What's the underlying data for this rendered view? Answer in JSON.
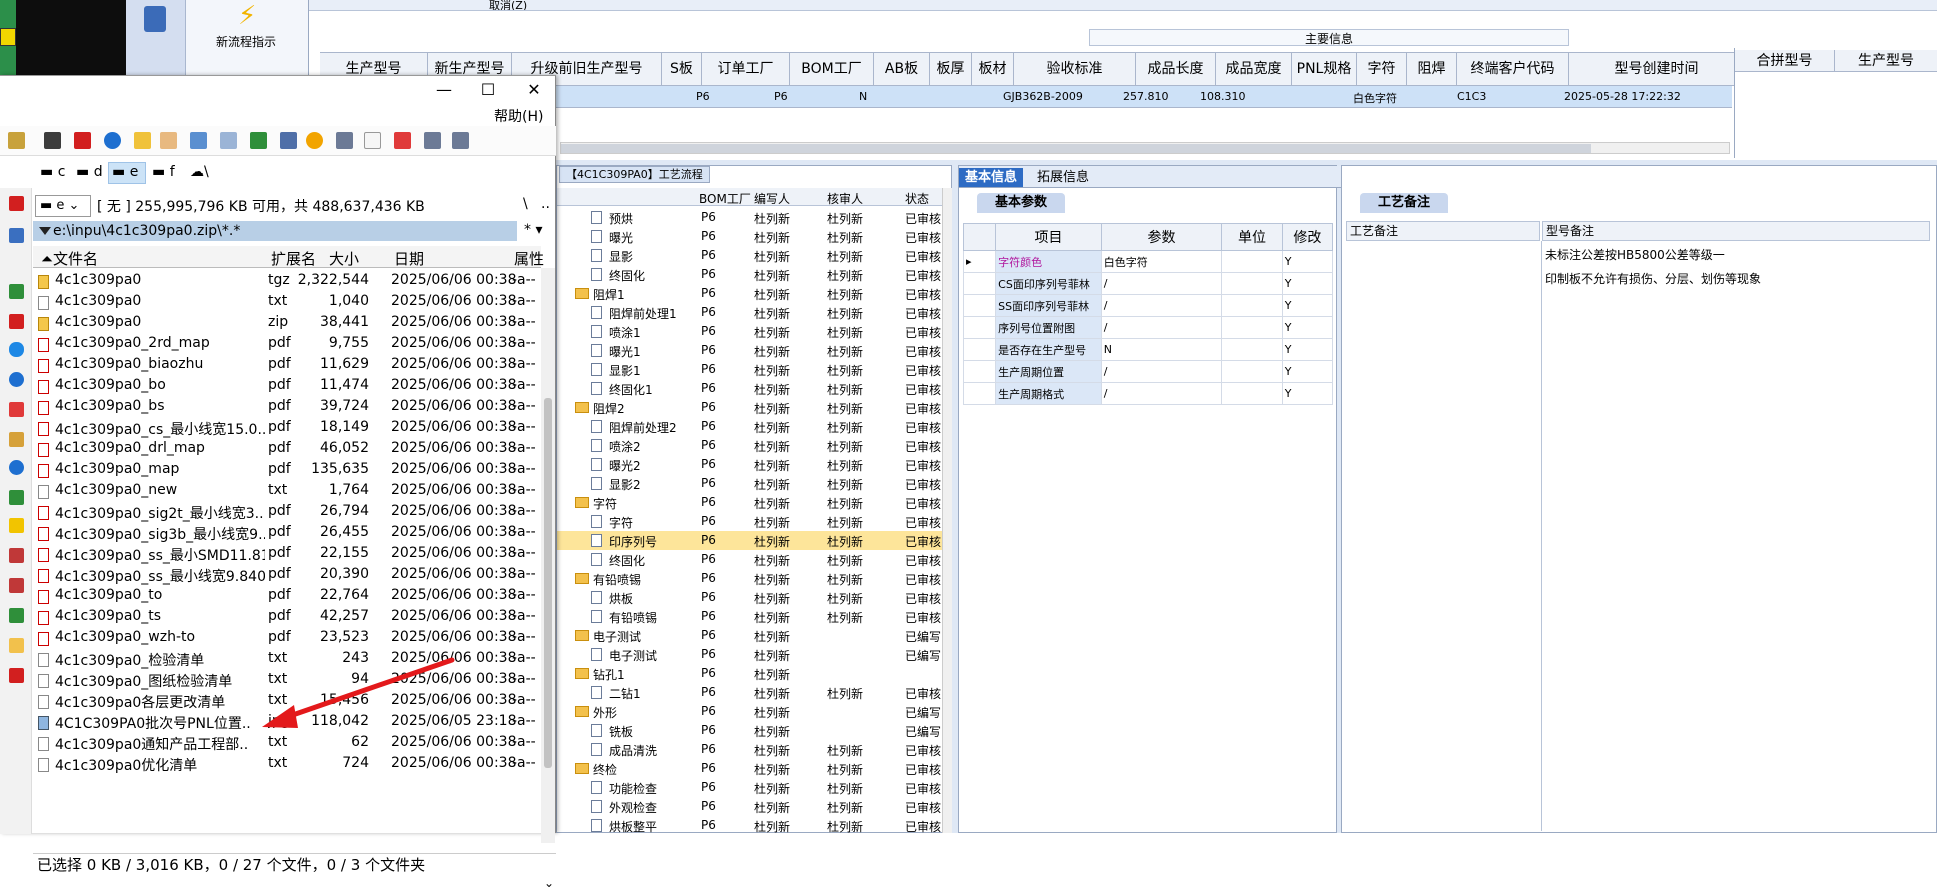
{
  "erp": {
    "toolbar": {
      "new_process_label": "新流程指示",
      "cancel_label": "取消(Z)"
    },
    "main_info_title": "主要信息",
    "columns": [
      "生产型号",
      "新生产型号",
      "升级前旧生产型号",
      "S板",
      "订单工厂",
      "BOM工厂",
      "AB板",
      "板厚",
      "板材",
      "验收标准",
      "成品长度",
      "成品宽度",
      "PNL规格",
      "字符",
      "阻焊",
      "终端客户代码",
      "型号创建时间"
    ],
    "right_columns": [
      "合拼型号",
      "生产型号"
    ],
    "selected_row": {
      "order_factory": "P6",
      "bom_factory": "P6",
      "ab": "N",
      "standard": "GJB362B-2009",
      "length": "257.810",
      "width": "108.310",
      "character": "白色字符",
      "customer": "C1C3",
      "created": "2025-05-28 17:22:32"
    },
    "process_tab": "【4C1C309PA0】工艺流程",
    "process_columns": [
      "BOM工厂",
      "编写人",
      "核审人",
      "状态"
    ],
    "process_rows": [
      {
        "name": "预烘",
        "indent": 2,
        "folder": false,
        "bom": "P6",
        "writer": "杜列新",
        "reviewer": "杜列新",
        "status": "已审核"
      },
      {
        "name": "曝光",
        "indent": 2,
        "folder": false,
        "bom": "P6",
        "writer": "杜列新",
        "reviewer": "杜列新",
        "status": "已审核"
      },
      {
        "name": "显影",
        "indent": 2,
        "folder": false,
        "bom": "P6",
        "writer": "杜列新",
        "reviewer": "杜列新",
        "status": "已审核"
      },
      {
        "name": "终固化",
        "indent": 2,
        "folder": false,
        "bom": "P6",
        "writer": "杜列新",
        "reviewer": "杜列新",
        "status": "已审核"
      },
      {
        "name": "阻焊1",
        "indent": 1,
        "folder": true,
        "bom": "P6",
        "writer": "杜列新",
        "reviewer": "杜列新",
        "status": "已审核"
      },
      {
        "name": "阻焊前处理1",
        "indent": 2,
        "folder": false,
        "bom": "P6",
        "writer": "杜列新",
        "reviewer": "杜列新",
        "status": "已审核"
      },
      {
        "name": "喷涂1",
        "indent": 2,
        "folder": false,
        "bom": "P6",
        "writer": "杜列新",
        "reviewer": "杜列新",
        "status": "已审核"
      },
      {
        "name": "曝光1",
        "indent": 2,
        "folder": false,
        "bom": "P6",
        "writer": "杜列新",
        "reviewer": "杜列新",
        "status": "已审核"
      },
      {
        "name": "显影1",
        "indent": 2,
        "folder": false,
        "bom": "P6",
        "writer": "杜列新",
        "reviewer": "杜列新",
        "status": "已审核"
      },
      {
        "name": "终固化1",
        "indent": 2,
        "folder": false,
        "bom": "P6",
        "writer": "杜列新",
        "reviewer": "杜列新",
        "status": "已审核"
      },
      {
        "name": "阻焊2",
        "indent": 1,
        "folder": true,
        "bom": "P6",
        "writer": "杜列新",
        "reviewer": "杜列新",
        "status": "已审核"
      },
      {
        "name": "阻焊前处理2",
        "indent": 2,
        "folder": false,
        "bom": "P6",
        "writer": "杜列新",
        "reviewer": "杜列新",
        "status": "已审核"
      },
      {
        "name": "喷涂2",
        "indent": 2,
        "folder": false,
        "bom": "P6",
        "writer": "杜列新",
        "reviewer": "杜列新",
        "status": "已审核"
      },
      {
        "name": "曝光2",
        "indent": 2,
        "folder": false,
        "bom": "P6",
        "writer": "杜列新",
        "reviewer": "杜列新",
        "status": "已审核"
      },
      {
        "name": "显影2",
        "indent": 2,
        "folder": false,
        "bom": "P6",
        "writer": "杜列新",
        "reviewer": "杜列新",
        "status": "已审核"
      },
      {
        "name": "字符",
        "indent": 1,
        "folder": true,
        "bom": "P6",
        "writer": "杜列新",
        "reviewer": "杜列新",
        "status": "已审核"
      },
      {
        "name": "字符",
        "indent": 2,
        "folder": false,
        "bom": "P6",
        "writer": "杜列新",
        "reviewer": "杜列新",
        "status": "已审核"
      },
      {
        "name": "印序列号",
        "indent": 2,
        "folder": false,
        "bom": "P6",
        "writer": "杜列新",
        "reviewer": "杜列新",
        "status": "已审核",
        "highlight": true
      },
      {
        "name": "终固化",
        "indent": 2,
        "folder": false,
        "bom": "P6",
        "writer": "杜列新",
        "reviewer": "杜列新",
        "status": "已审核"
      },
      {
        "name": "有铅喷锡",
        "indent": 1,
        "folder": true,
        "bom": "P6",
        "writer": "杜列新",
        "reviewer": "杜列新",
        "status": "已审核"
      },
      {
        "name": "烘板",
        "indent": 2,
        "folder": false,
        "bom": "P6",
        "writer": "杜列新",
        "reviewer": "杜列新",
        "status": "已审核"
      },
      {
        "name": "有铅喷锡",
        "indent": 2,
        "folder": false,
        "bom": "P6",
        "writer": "杜列新",
        "reviewer": "杜列新",
        "status": "已审核"
      },
      {
        "name": "电子测试",
        "indent": 1,
        "folder": true,
        "bom": "P6",
        "writer": "杜列新",
        "reviewer": "",
        "status": "已编写"
      },
      {
        "name": "电子测试",
        "indent": 2,
        "folder": false,
        "bom": "P6",
        "writer": "杜列新",
        "reviewer": "",
        "status": "已编写"
      },
      {
        "name": "钻孔1",
        "indent": 1,
        "folder": true,
        "bom": "P6",
        "writer": "杜列新",
        "reviewer": "",
        "status": ""
      },
      {
        "name": "二钻1",
        "indent": 2,
        "folder": false,
        "bom": "P6",
        "writer": "杜列新",
        "reviewer": "杜列新",
        "status": "已审核"
      },
      {
        "name": "外形",
        "indent": 1,
        "folder": true,
        "bom": "P6",
        "writer": "杜列新",
        "reviewer": "",
        "status": "已编写"
      },
      {
        "name": "铣板",
        "indent": 2,
        "folder": false,
        "bom": "P6",
        "writer": "杜列新",
        "reviewer": "",
        "status": "已编写"
      },
      {
        "name": "成品清洗",
        "indent": 2,
        "folder": false,
        "bom": "P6",
        "writer": "杜列新",
        "reviewer": "杜列新",
        "status": "已审核"
      },
      {
        "name": "终检",
        "indent": 1,
        "folder": true,
        "bom": "P6",
        "writer": "杜列新",
        "reviewer": "杜列新",
        "status": "已审核"
      },
      {
        "name": "功能检查",
        "indent": 2,
        "folder": false,
        "bom": "P6",
        "writer": "杜列新",
        "reviewer": "杜列新",
        "status": "已审核"
      },
      {
        "name": "外观检查",
        "indent": 2,
        "folder": false,
        "bom": "P6",
        "writer": "杜列新",
        "reviewer": "杜列新",
        "status": "已审核"
      },
      {
        "name": "烘板整平",
        "indent": 2,
        "folder": false,
        "bom": "P6",
        "writer": "杜列新",
        "reviewer": "杜列新",
        "status": "已审核"
      }
    ],
    "basic_tabs": [
      "基本信息",
      "拓展信息"
    ],
    "basic_sub": "基本参数",
    "param_columns": [
      "项目",
      "参数",
      "单位",
      "修改"
    ],
    "params": [
      {
        "item": "字符颜色",
        "value": "白色字符",
        "unit": "",
        "mod": "Y"
      },
      {
        "item": "CS面印序列号菲林",
        "value": "/",
        "unit": "",
        "mod": "Y"
      },
      {
        "item": "SS面印序列号菲林",
        "value": "/",
        "unit": "",
        "mod": "Y"
      },
      {
        "item": "序列号位置附图",
        "value": "/",
        "unit": "",
        "mod": "Y"
      },
      {
        "item": "是否存在生产型号",
        "value": "N",
        "unit": "",
        "mod": "Y"
      },
      {
        "item": "生产周期位置",
        "value": "/",
        "unit": "",
        "mod": "Y"
      },
      {
        "item": "生产周期格式",
        "value": "/",
        "unit": "",
        "mod": "Y"
      }
    ],
    "note_tab": "工艺备注",
    "note_col1": "工艺备注",
    "note_col2": "型号备注",
    "notes": [
      "未标注公差按HB5800公差等级一",
      "印制板不允许有损伤、分层、划伤等现象"
    ]
  },
  "fm": {
    "help_menu": "帮助(H)",
    "drives": [
      "c",
      "d",
      "e",
      "f",
      "\\"
    ],
    "drive_combo": "e",
    "free_space": "[ 无 ] 255,995,796 KB 可用，共 488,637,436 KB",
    "nav_back": "\\",
    "nav_up": "..",
    "path": "e:\\inpu\\4c1c309pa0.zip\\*.*",
    "path_right": "* ▾",
    "columns": [
      "文件名",
      "扩展名",
      "大小",
      "日期",
      "属性"
    ],
    "files": [
      {
        "name": "4c1c309pa0",
        "ext": "tgz",
        "size": "2,322,544",
        "date": "2025/06/06 00:38",
        "attr": "-a--",
        "type": "zip"
      },
      {
        "name": "4c1c309pa0",
        "ext": "txt",
        "size": "1,040",
        "date": "2025/06/06 00:38",
        "attr": "-a--",
        "type": "txt"
      },
      {
        "name": "4c1c309pa0",
        "ext": "zip",
        "size": "38,441",
        "date": "2025/06/06 00:38",
        "attr": "-a--",
        "type": "zip"
      },
      {
        "name": "4c1c309pa0_2rd_map",
        "ext": "pdf",
        "size": "9,755",
        "date": "2025/06/06 00:38",
        "attr": "-a--",
        "type": "pdf"
      },
      {
        "name": "4c1c309pa0_biaozhu",
        "ext": "pdf",
        "size": "11,629",
        "date": "2025/06/06 00:38",
        "attr": "-a--",
        "type": "pdf"
      },
      {
        "name": "4c1c309pa0_bo",
        "ext": "pdf",
        "size": "11,474",
        "date": "2025/06/06 00:38",
        "attr": "-a--",
        "type": "pdf"
      },
      {
        "name": "4c1c309pa0_bs",
        "ext": "pdf",
        "size": "39,724",
        "date": "2025/06/06 00:38",
        "attr": "-a--",
        "type": "pdf"
      },
      {
        "name": "4c1c309pa0_cs_最小线宽15.0..",
        "ext": "pdf",
        "size": "18,149",
        "date": "2025/06/06 00:38",
        "attr": "-a--",
        "type": "pdf"
      },
      {
        "name": "4c1c309pa0_drl_map",
        "ext": "pdf",
        "size": "46,052",
        "date": "2025/06/06 00:38",
        "attr": "-a--",
        "type": "pdf"
      },
      {
        "name": "4c1c309pa0_map",
        "ext": "pdf",
        "size": "135,635",
        "date": "2025/06/06 00:38",
        "attr": "-a--",
        "type": "pdf"
      },
      {
        "name": "4c1c309pa0_new",
        "ext": "txt",
        "size": "1,764",
        "date": "2025/06/06 00:38",
        "attr": "-a--",
        "type": "txt"
      },
      {
        "name": "4c1c309pa0_sig2t_最小线宽3..",
        "ext": "pdf",
        "size": "26,794",
        "date": "2025/06/06 00:38",
        "attr": "-a--",
        "type": "pdf"
      },
      {
        "name": "4c1c309pa0_sig3b_最小线宽9..",
        "ext": "pdf",
        "size": "26,455",
        "date": "2025/06/06 00:38",
        "attr": "-a--",
        "type": "pdf"
      },
      {
        "name": "4c1c309pa0_ss_最小SMD11.81",
        "ext": "pdf",
        "size": "22,155",
        "date": "2025/06/06 00:38",
        "attr": "-a--",
        "type": "pdf"
      },
      {
        "name": "4c1c309pa0_ss_最小线宽9.840",
        "ext": "pdf",
        "size": "20,390",
        "date": "2025/06/06 00:38",
        "attr": "-a--",
        "type": "pdf"
      },
      {
        "name": "4c1c309pa0_to",
        "ext": "pdf",
        "size": "22,764",
        "date": "2025/06/06 00:38",
        "attr": "-a--",
        "type": "pdf"
      },
      {
        "name": "4c1c309pa0_ts",
        "ext": "pdf",
        "size": "42,257",
        "date": "2025/06/06 00:38",
        "attr": "-a--",
        "type": "pdf"
      },
      {
        "name": "4c1c309pa0_wzh-to",
        "ext": "pdf",
        "size": "23,523",
        "date": "2025/06/06 00:38",
        "attr": "-a--",
        "type": "pdf"
      },
      {
        "name": "4c1c309pa0_检验清单",
        "ext": "txt",
        "size": "243",
        "date": "2025/06/06 00:38",
        "attr": "-a--",
        "type": "txt"
      },
      {
        "name": "4c1c309pa0_图纸检验清单",
        "ext": "txt",
        "size": "94",
        "date": "2025/06/06 00:38",
        "attr": "-a--",
        "type": "txt"
      },
      {
        "name": "4c1c309pa0各层更改清单",
        "ext": "txt",
        "size": "15,456",
        "date": "2025/06/06 00:38",
        "attr": "-a--",
        "type": "txt"
      },
      {
        "name": "4C1C309PA0批次号PNL位置..",
        "ext": "jpg",
        "size": "118,042",
        "date": "2025/06/05 23:18",
        "attr": "-a--",
        "type": "jpg"
      },
      {
        "name": "4c1c309pa0通知产品工程部..",
        "ext": "txt",
        "size": "62",
        "date": "2025/06/06 00:38",
        "attr": "-a--",
        "type": "txt"
      },
      {
        "name": "4c1c309pa0优化清单",
        "ext": "txt",
        "size": "724",
        "date": "2025/06/06 00:38",
        "attr": "-a--",
        "type": "txt"
      }
    ],
    "status": "已选择 0 KB / 3,016 KB，0 / 27 个文件，0 / 3 个文件夹"
  },
  "colors": {
    "accent": "#2d6bc4",
    "highlight": "#fde59a",
    "selection": "#cde1f7",
    "arrow": "#e3191b"
  }
}
